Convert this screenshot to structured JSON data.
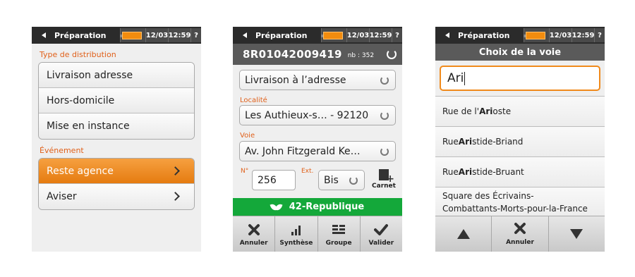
{
  "status": {
    "back_label": "Préparation",
    "date": "12/03",
    "time": "12:59",
    "help": "?",
    "battery_color": "#f28c0e"
  },
  "screen1": {
    "distribution_label": "Type de distribution",
    "distribution_options": [
      "Livraison adresse",
      "Hors-domicile",
      "Mise en instance"
    ],
    "event_label": "Événement",
    "event_options": [
      "Reste agence",
      "Aviser"
    ],
    "selected_event": "Reste agence"
  },
  "screen2": {
    "tracking_number": "8R01042009419",
    "count": "nb : 352",
    "delivery_type": "Livraison à l’adresse",
    "locality_label": "Localité",
    "locality_value": "Les Authieux-s… - 92120",
    "voie_label": "Voie",
    "voie_value": "Av. John Fitzgerald Ke…",
    "number_label": "N°",
    "number_value": "256",
    "ext_label": "Ext.",
    "ext_value": "Bis",
    "carnet_label": "Carnet",
    "tournee": "42-Republique",
    "tournee_color": "#14a83a",
    "toolbar": [
      "Annuler",
      "Synthèse",
      "Groupe",
      "Valider"
    ]
  },
  "screen3": {
    "title": "Choix de la voie",
    "search_value": "Ari",
    "results": [
      {
        "pre": "Rue de l'",
        "match": "Ari",
        "post": "oste"
      },
      {
        "pre": "Rue ",
        "match": "Ari",
        "post": "stide-Briand"
      },
      {
        "pre": "Rue ",
        "match": "Ari",
        "post": "stide-Bruant"
      }
    ],
    "result_multi_line1": "Square des Écrivains-",
    "result_multi_line2": "Combattants-Morts-pour-la-France",
    "cancel_label": "Annuler"
  }
}
